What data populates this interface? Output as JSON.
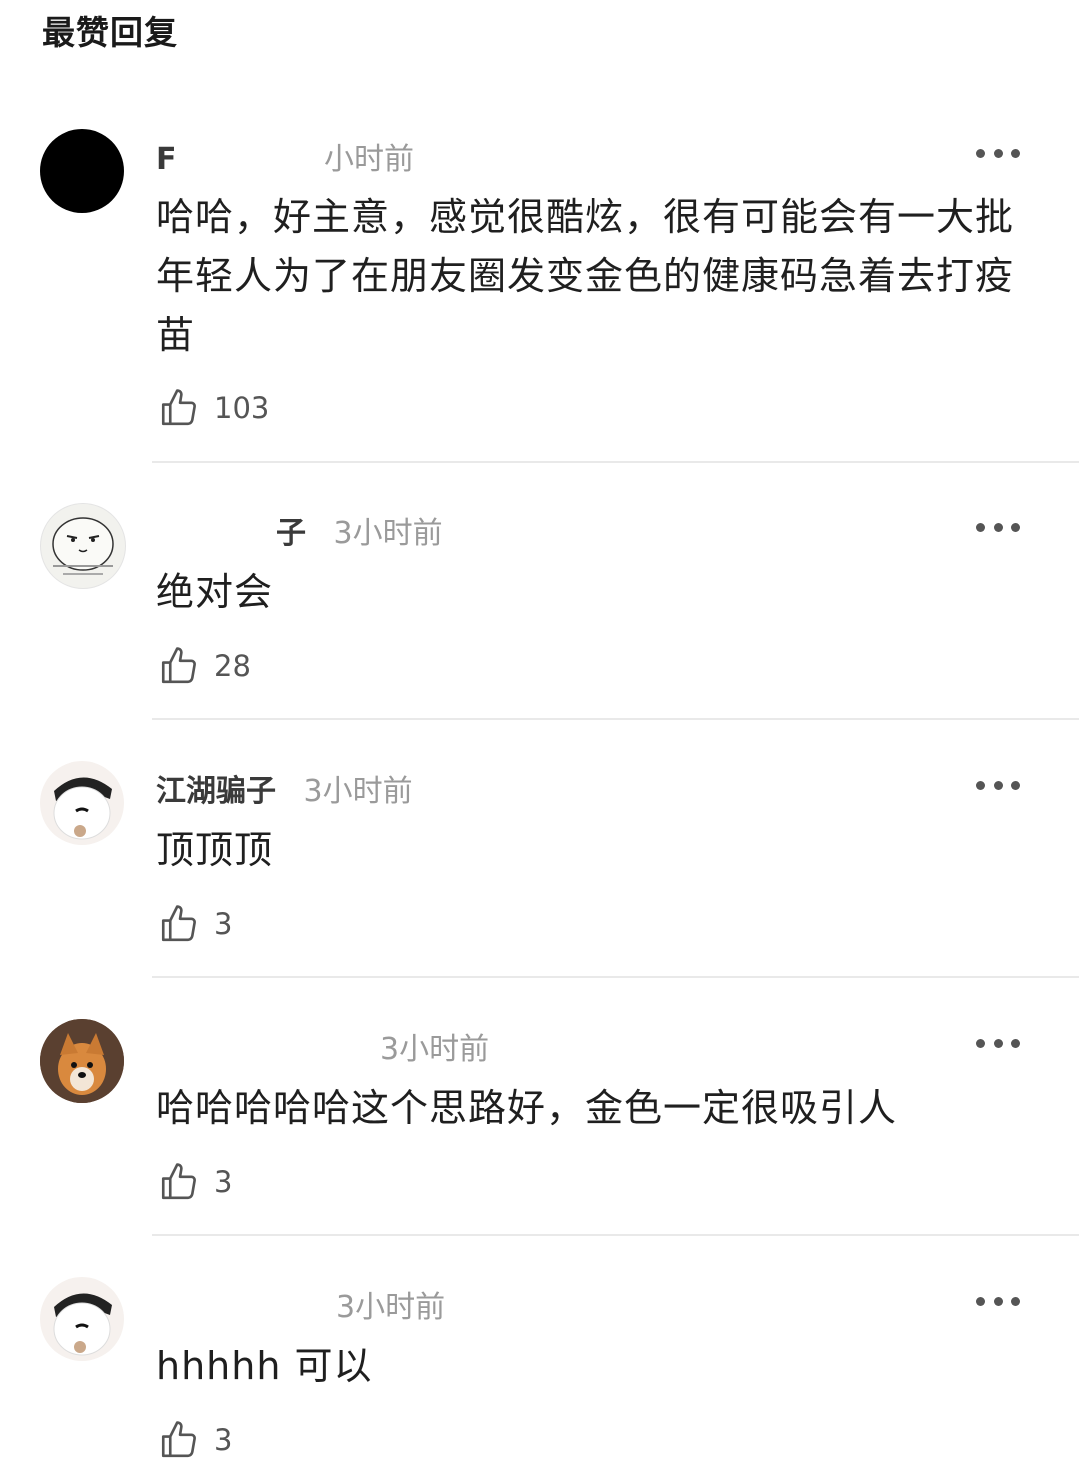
{
  "section_title": "最赞回复",
  "comments": [
    {
      "username": "F",
      "time": "小时前",
      "text": "哈哈，好主意，感觉很酷炫，很有可能会有一大批年轻人为了在朋友圈发变金色的健康码急着去打疫苗",
      "likes": "103",
      "avatar": "black-circle"
    },
    {
      "username": "子",
      "time": "3小时前",
      "text": "绝对会",
      "likes": "28",
      "avatar": "cartoon-face"
    },
    {
      "username": "江湖骗子",
      "time": "3小时前",
      "text": "顶顶顶",
      "likes": "3",
      "avatar": "cartoon-character"
    },
    {
      "username": "",
      "time": "3小时前",
      "text": "哈哈哈哈哈这个思路好，金色一定很吸引人",
      "likes": "3",
      "avatar": "dog-photo"
    },
    {
      "username": "",
      "time": "3小时前",
      "text": "hhhhh 可以",
      "likes": "3",
      "avatar": "cartoon-character"
    }
  ]
}
